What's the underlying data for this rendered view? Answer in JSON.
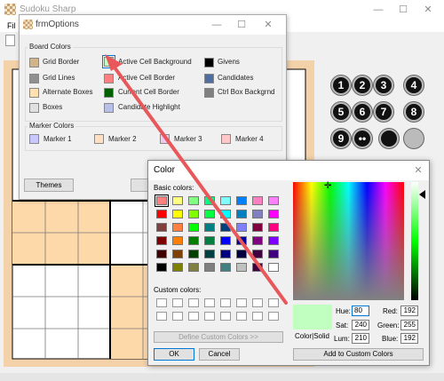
{
  "main_window": {
    "title": "Sudoku Sharp",
    "menu_first": "Fil"
  },
  "number_buttons": [
    "1",
    "2",
    "3",
    "4",
    "5",
    "6",
    "7",
    "8",
    "9",
    "••"
  ],
  "options_dialog": {
    "title": "frmOptions",
    "board_colors_label": "Board Colors",
    "board_items": [
      {
        "label": "Grid Border",
        "color": "#d2b48c"
      },
      {
        "label": "Active Cell Background",
        "color": "#c0ffc0"
      },
      {
        "label": "Givens",
        "color": "#000000"
      },
      {
        "label": "Grid Lines",
        "color": "#909090"
      },
      {
        "label": "Active Cell Border",
        "color": "#ff8080"
      },
      {
        "label": "Candidates",
        "color": "#4f6fa0"
      },
      {
        "label": "Alternate Boxes",
        "color": "#ffe0b0"
      },
      {
        "label": "Current Cell Border",
        "color": "#006000"
      },
      {
        "label": "Ctrl Box Backgrnd",
        "color": "#808080"
      },
      {
        "label": "Boxes",
        "color": "#e0e0e0"
      },
      {
        "label": "Candidate Highlight",
        "color": "#b8c0e8"
      }
    ],
    "marker_colors_label": "Marker Colors",
    "markers": [
      {
        "label": "Marker 1",
        "color": "#c8c8ff"
      },
      {
        "label": "Marker 2",
        "color": "#ffe0c0"
      },
      {
        "label": "Marker 3",
        "color": "#f0c8f0"
      },
      {
        "label": "Marker 4",
        "color": "#ffc8c8"
      }
    ],
    "themes_button": "Themes",
    "second_button_partial": "Up"
  },
  "color_dialog": {
    "title": "Color",
    "basic_colors_label": "Basic colors:",
    "basic_colors": [
      "#ff8080",
      "#ffff80",
      "#80ff80",
      "#00ff80",
      "#80ffff",
      "#0080ff",
      "#ff80c0",
      "#ff80ff",
      "#ff0000",
      "#ffff00",
      "#80ff00",
      "#00ff40",
      "#00ffff",
      "#0080c0",
      "#8080c0",
      "#ff00ff",
      "#804040",
      "#ff8040",
      "#00ff00",
      "#008080",
      "#004080",
      "#8080ff",
      "#800040",
      "#ff0080",
      "#800000",
      "#ff8000",
      "#008000",
      "#008040",
      "#0000ff",
      "#0000a0",
      "#800080",
      "#8000ff",
      "#400000",
      "#804000",
      "#004000",
      "#004040",
      "#000080",
      "#000040",
      "#400040",
      "#400080",
      "#000000",
      "#808000",
      "#808040",
      "#808080",
      "#408080",
      "#c0c0c0",
      "#400040",
      "#ffffff"
    ],
    "custom_colors_label": "Custom colors:",
    "define_custom_button": "Define Custom Colors >>",
    "ok_button": "OK",
    "cancel_button": "Cancel",
    "color_solid_label": "Color|Solid",
    "preview_color": "#c0ffc0",
    "hue_label": "Hue:",
    "hue_value": "80",
    "sat_label": "Sat:",
    "sat_value": "240",
    "lum_label": "Lum:",
    "lum_value": "210",
    "red_label": "Red:",
    "red_value": "192",
    "green_label": "Green:",
    "green_value": "255",
    "blue_label": "Blue:",
    "blue_value": "192",
    "add_custom_button": "Add to Custom Colors"
  },
  "annotation_arrow_color": "#e8575a"
}
